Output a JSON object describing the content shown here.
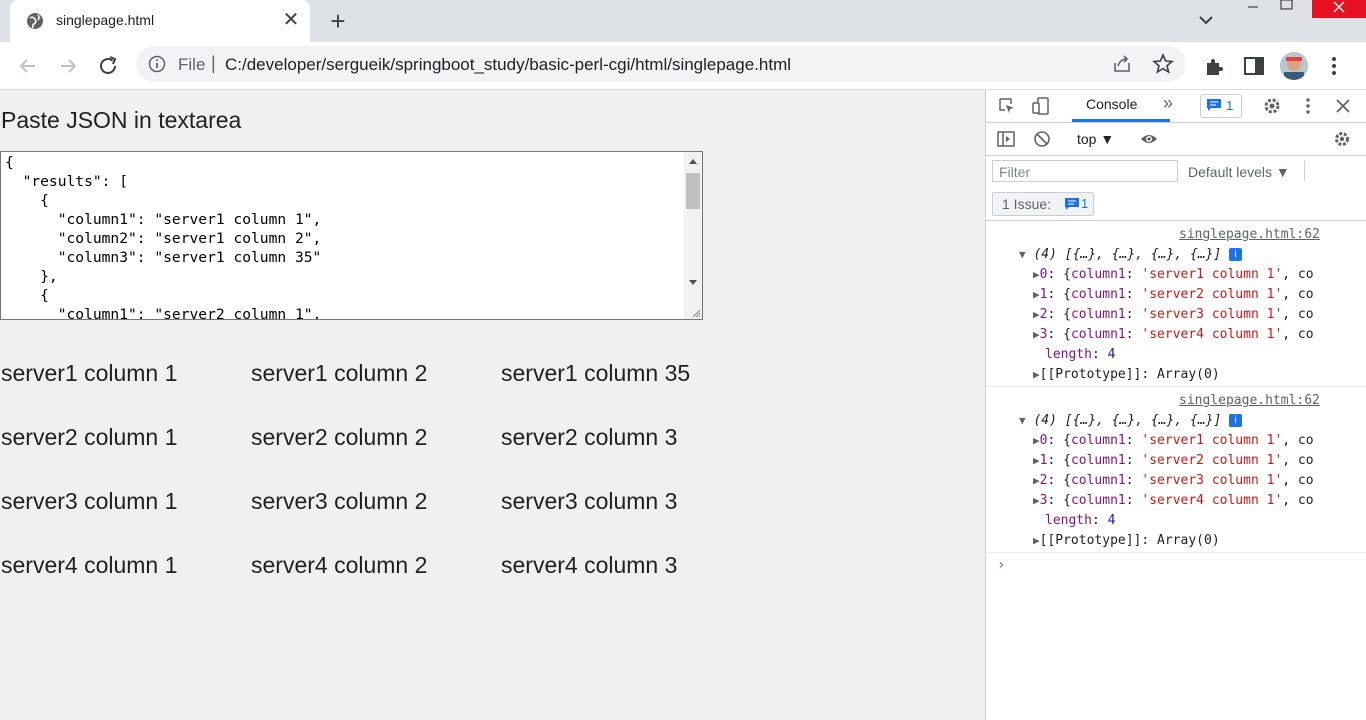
{
  "browser": {
    "tab_title": "singlepage.html",
    "tab_close": "✕",
    "new_tab": "+",
    "url_scheme": "File",
    "url_separator": "|",
    "url": "C:/developer/sergueik/springboot_study/basic-perl-cgi/html/singlepage.html"
  },
  "page": {
    "heading": "Paste JSON in textarea",
    "textarea_value": "{\n  \"results\": [\n    {\n      \"column1\": \"server1 column 1\",\n      \"column2\": \"server1 column 2\",\n      \"column3\": \"server1 column 35\"\n    },\n    {\n      \"column1\": \"server2 column 1\",",
    "results": [
      [
        "server1 column 1",
        "server1 column 2",
        "server1 column 35"
      ],
      [
        "server2 column 1",
        "server2 column 2",
        "server2 column 3"
      ],
      [
        "server3 column 1",
        "server3 column 2",
        "server3 column 3"
      ],
      [
        "server4 column 1",
        "server4 column 2",
        "server4 column 3"
      ]
    ]
  },
  "devtools": {
    "tab_console": "Console",
    "more_tabs": "»",
    "issues_badge_count": "1",
    "context": "top ▼",
    "filter_placeholder": "Filter",
    "levels": "Default levels ▼",
    "issues_label": "1 Issue:",
    "issues_count": "1",
    "log_groups": [
      {
        "source": "singlepage.html:62",
        "header": "(4) [{…}, {…}, {…}, {…}]",
        "items": [
          {
            "key": "0",
            "value": "'server1 column 1'"
          },
          {
            "key": "1",
            "value": "'server2 column 1'"
          },
          {
            "key": "2",
            "value": "'server3 column 1'"
          },
          {
            "key": "3",
            "value": "'server4 column 1'"
          }
        ],
        "length": "4",
        "prototype": "Array(0)"
      },
      {
        "source": "singlepage.html:62",
        "header": "(4) [{…}, {…}, {…}, {…}]",
        "items": [
          {
            "key": "0",
            "value": "'server1 column 1'"
          },
          {
            "key": "1",
            "value": "'server2 column 1'"
          },
          {
            "key": "2",
            "value": "'server3 column 1'"
          },
          {
            "key": "3",
            "value": "'server4 column 1'"
          }
        ],
        "length": "4",
        "prototype": "Array(0)"
      }
    ],
    "prompt": "›"
  }
}
